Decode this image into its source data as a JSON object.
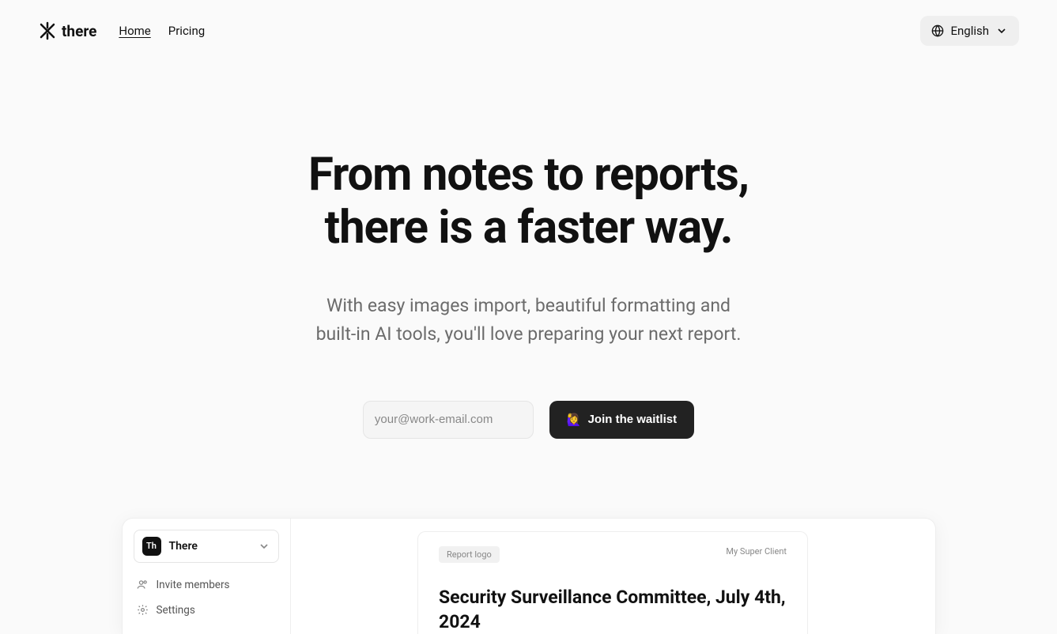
{
  "header": {
    "brand": "there",
    "nav": {
      "home": "Home",
      "pricing": "Pricing"
    },
    "language": "English"
  },
  "hero": {
    "title_line1": "From notes to reports,",
    "title_line2": "there is a faster way.",
    "sub_line1": "With easy images import, beautiful formatting and",
    "sub_line2": "built-in AI tools, you'll love preparing your next report.",
    "email_placeholder": "your@work-email.com",
    "cta_emoji": "🙋‍♀️",
    "cta_label": "Join the waitlist"
  },
  "preview": {
    "workspace_badge": "Th",
    "workspace_name": "There",
    "sidebar": {
      "invite": "Invite members",
      "settings": "Settings"
    },
    "report": {
      "logo_chip": "Report logo",
      "client": "My Super Client",
      "title": "Security Surveillance Committee, July 4th, 2024"
    }
  }
}
